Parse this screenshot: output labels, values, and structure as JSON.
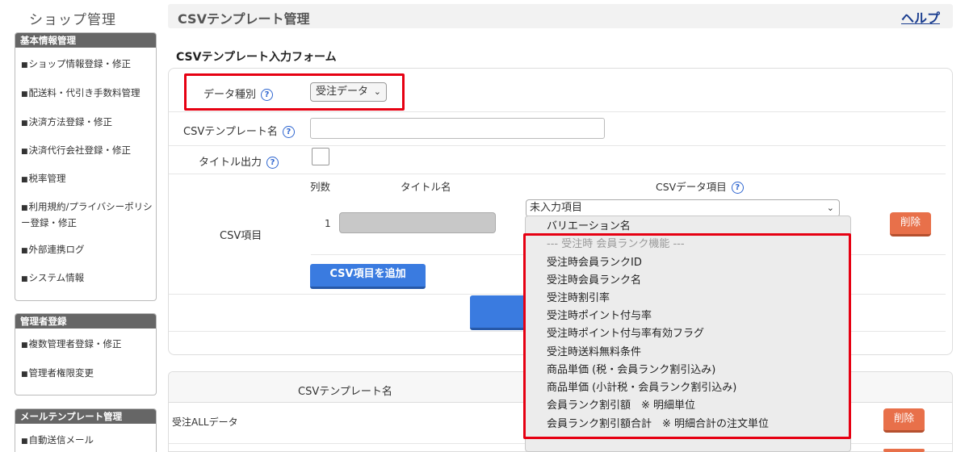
{
  "sidebar": {
    "shop_title": "ショップ管理",
    "sections": [
      {
        "title": "基本情報管理",
        "items": [
          "ショップ情報登録・修正",
          "配送料・代引き手数料管理",
          "決済方法登録・修正",
          "決済代行会社登録・修正",
          "税率管理",
          "利用規約/プライバシーポリシー登録・修正",
          "外部連携ログ",
          "システム情報"
        ]
      },
      {
        "title": "管理者登録",
        "items": [
          "複数管理者登録・修正",
          "管理者権限変更"
        ]
      },
      {
        "title": "メールテンプレート管理",
        "items": [
          "自動送信メール"
        ]
      }
    ]
  },
  "header": {
    "title": "CSVテンプレート管理",
    "help": "ヘルプ"
  },
  "form": {
    "heading": "CSVテンプレート入力フォーム",
    "data_type_label": "データ種別",
    "data_type_value": "受注データ",
    "template_name_label": "CSVテンプレート名",
    "template_name_value": "",
    "title_output_label": "タイトル出力",
    "csv_items_label": "CSV項目",
    "col_number": "列数",
    "col_title": "タイトル名",
    "col_data": "CSVデータ項目",
    "row_number": "1",
    "row_select_value": "未入力項目",
    "delete": "削除",
    "add_item": "CSV項目を追加"
  },
  "dropdown": {
    "items": [
      {
        "label": "バリエーション名",
        "disabled": false
      },
      {
        "label": "--- 受注時 会員ランク機能 ---",
        "disabled": true
      },
      {
        "label": "受注時会員ランクID",
        "disabled": false
      },
      {
        "label": "受注時会員ランク名",
        "disabled": false
      },
      {
        "label": "受注時割引率",
        "disabled": false
      },
      {
        "label": "受注時ポイント付与率",
        "disabled": false
      },
      {
        "label": "受注時ポイント付与率有効フラグ",
        "disabled": false
      },
      {
        "label": "受注時送料無料条件",
        "disabled": false
      },
      {
        "label": "商品単価 (税・会員ランク割引込み)",
        "disabled": false
      },
      {
        "label": "商品単価 (小計税・会員ランク割引込み)",
        "disabled": false
      },
      {
        "label": "会員ランク割引額　※ 明細単位",
        "disabled": false
      },
      {
        "label": "会員ランク割引額合計　※ 明細合計の注文単位",
        "disabled": false
      }
    ]
  },
  "table": {
    "header_name": "CSVテンプレート名",
    "rows": [
      {
        "name": "受注ALLデータ",
        "delete": "削除"
      }
    ]
  },
  "colors": {
    "highlight": "#e60012",
    "primary_button": "#3a7be0",
    "delete_button": "#e8704a",
    "help_link": "#1a3d8f"
  }
}
